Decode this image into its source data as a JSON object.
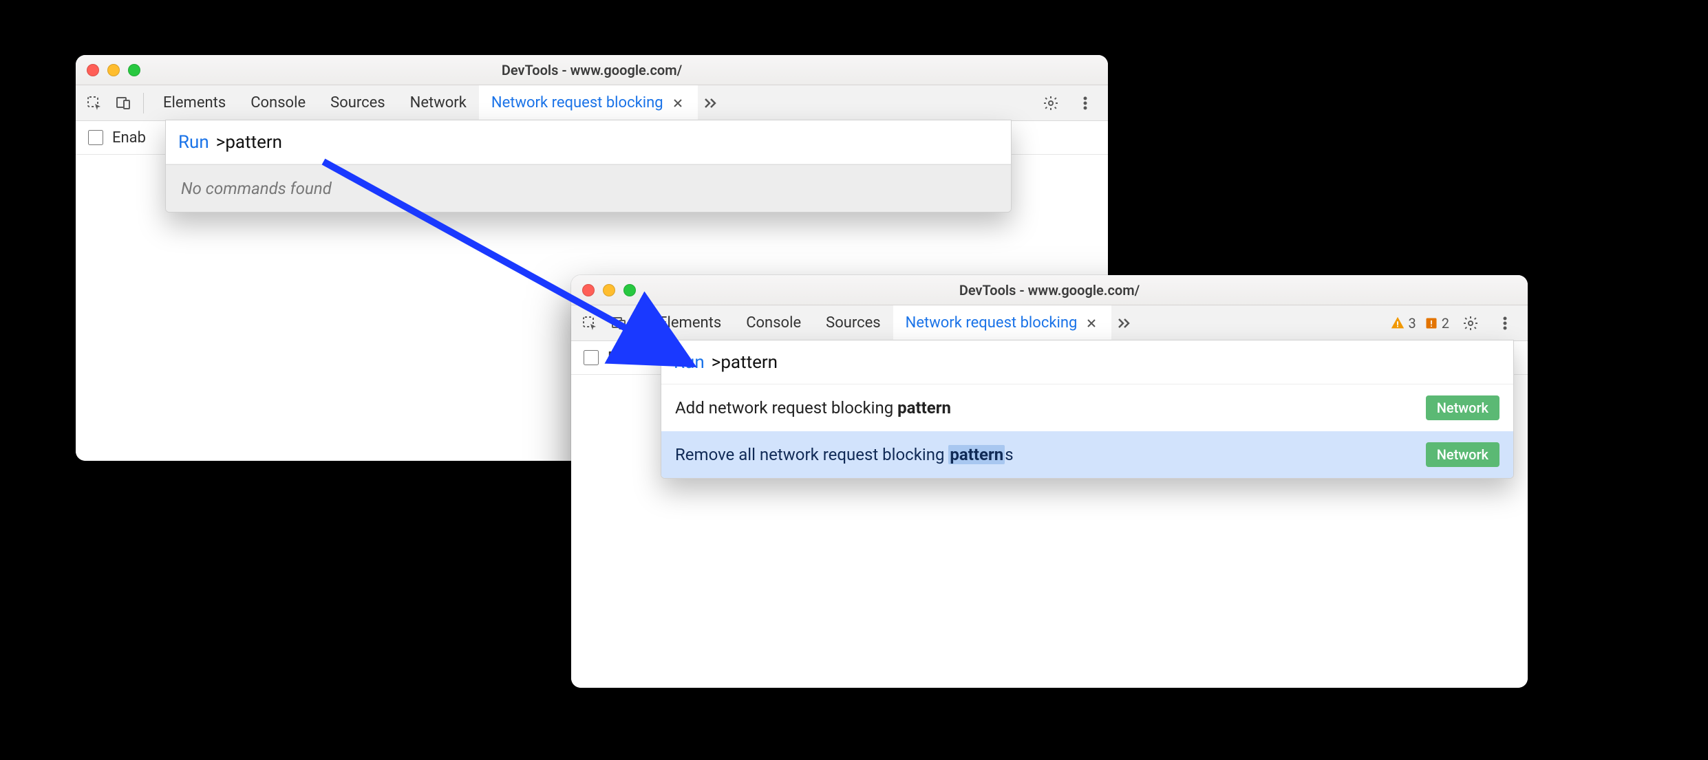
{
  "window1": {
    "title": "DevTools - www.google.com/",
    "tabs": [
      "Elements",
      "Console",
      "Sources",
      "Network",
      "Network request blocking"
    ],
    "active_tab_index": 4,
    "enable_label": "Enab",
    "palette": {
      "run_label": "Run",
      "prefix": ">",
      "query": "pattern",
      "empty_message": "No commands found"
    }
  },
  "window2": {
    "title": "DevTools - www.google.com/",
    "tabs": [
      "Elements",
      "Console",
      "Sources",
      "Network request blocking"
    ],
    "active_tab_index": 3,
    "enable_label": "Enab",
    "warning_count": "3",
    "issue_count": "2",
    "palette": {
      "run_label": "Run",
      "prefix": ">",
      "query": "pattern",
      "items": [
        {
          "pre": "Add network request blocking ",
          "match": "pattern",
          "post": "",
          "tag": "Network"
        },
        {
          "pre": "Remove all network request blocking ",
          "match": "pattern",
          "post": "s",
          "tag": "Network"
        }
      ],
      "highlight_index": 1
    }
  }
}
